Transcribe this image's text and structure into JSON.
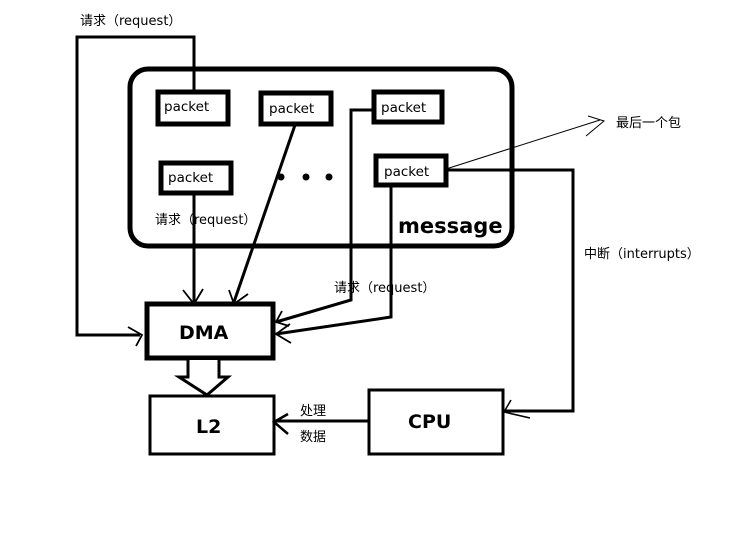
{
  "diagram": {
    "message_container": {
      "label": "message"
    },
    "packets": [
      {
        "id": "p1",
        "label": "packet"
      },
      {
        "id": "p2",
        "label": "packet"
      },
      {
        "id": "p3",
        "label": "packet"
      },
      {
        "id": "p4",
        "label": "packet"
      },
      {
        "id": "p5",
        "label": "packet"
      }
    ],
    "ellipsis": "• • •",
    "blocks": {
      "dma": "DMA",
      "l2": "L2",
      "cpu": "CPU"
    },
    "labels": {
      "request_top": "请求（request）",
      "request_inner": "请求（request）",
      "request_middle": "请求（request）",
      "last_packet": "最后一个包",
      "interrupts": "中断（interrupts）",
      "process": "处理",
      "data": "数据"
    },
    "edges": [
      {
        "from": "p1",
        "to": "DMA",
        "label": "请求（request）"
      },
      {
        "from": "p2",
        "to": "DMA"
      },
      {
        "from": "p3",
        "to": "DMA",
        "label": "请求（request）"
      },
      {
        "from": "p4",
        "to": "DMA",
        "label": "请求（request）"
      },
      {
        "from": "p5",
        "to": "DMA",
        "label": "请求（request）"
      },
      {
        "from": "p5",
        "to": "CPU",
        "label": "中断（interrupts）"
      },
      {
        "from": "DMA",
        "to": "L2"
      },
      {
        "from": "CPU",
        "to": "L2",
        "label": "处理数据"
      }
    ]
  }
}
